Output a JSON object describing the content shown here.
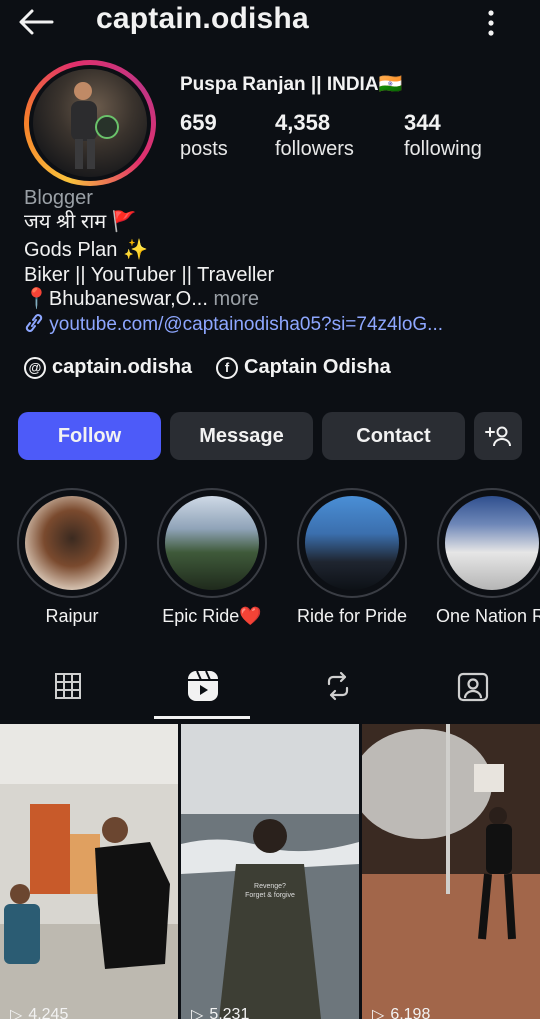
{
  "header": {
    "username": "captain.odisha",
    "icons": [
      "back-arrow-icon",
      "more-vertical-icon"
    ]
  },
  "profile": {
    "full_name": "Puspa Ranjan || INDIA🇮🇳",
    "stats": [
      {
        "value": "659",
        "label": "posts"
      },
      {
        "value": "4,358",
        "label": "followers"
      },
      {
        "value": "344",
        "label": "following"
      }
    ],
    "category": "Blogger",
    "bio_lines": [
      "जय श्री राम 🚩",
      "Gods Plan ✨",
      "Biker || YouTuber || Traveller"
    ],
    "location": "📍Bhubaneswar,O...",
    "more_label": "more",
    "link": "youtube.com/@captainodisha05?si=74z4loG...",
    "threads_handle": "captain.odisha",
    "facebook_name": "Captain Odisha"
  },
  "actions": {
    "follow": "Follow",
    "message": "Message",
    "contact": "Contact"
  },
  "highlights": [
    {
      "label": "Raipur"
    },
    {
      "label": "Epic Ride❤️"
    },
    {
      "label": "Ride for Pride"
    },
    {
      "label": "One Nation Ri"
    }
  ],
  "tabs": [
    "grid-icon",
    "reels-icon",
    "reposts-icon",
    "tagged-icon"
  ],
  "reels": [
    {
      "views": "4,245",
      "caption": ""
    },
    {
      "views": "5,231",
      "caption": "Revenge?\nForget & forgive"
    },
    {
      "views": "6,198",
      "caption": ""
    }
  ],
  "colors": {
    "accent": "#4d5bf9",
    "link": "#8ea7ff",
    "background": "#0c0f14"
  }
}
